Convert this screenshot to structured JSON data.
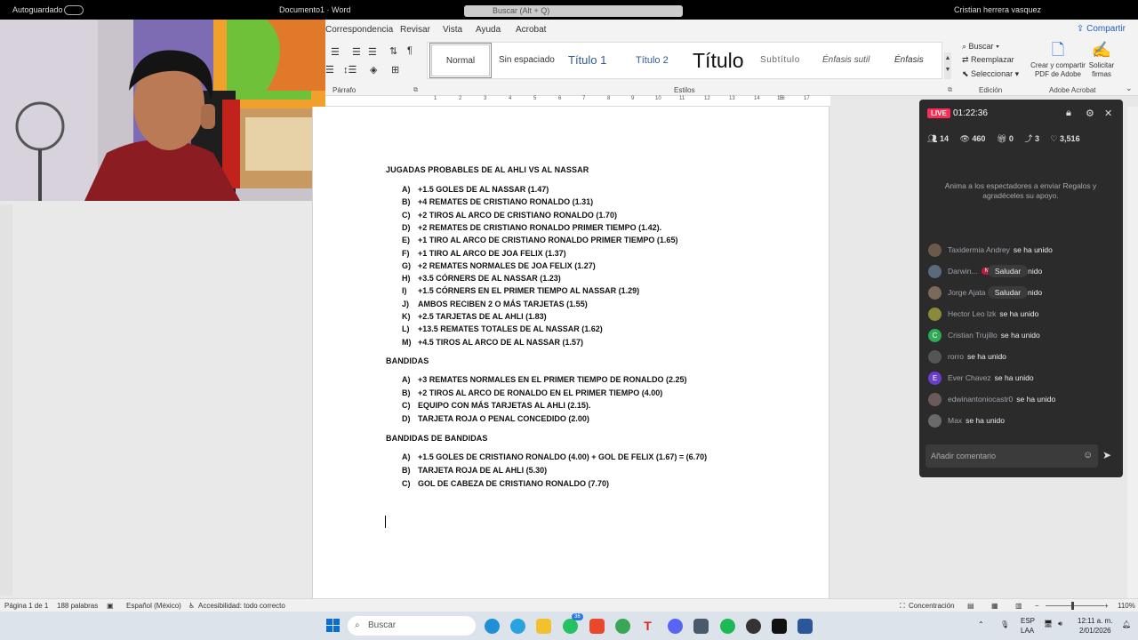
{
  "titlebar": {
    "autosave": "Autoguardado",
    "doc": "Documento1  ·  Word",
    "search": "Buscar (Alt + Q)",
    "user": "Cristian herrera vasquez"
  },
  "tabs": [
    "Correspondencia",
    "Revisar",
    "Vista",
    "Ayuda",
    "Acrobat"
  ],
  "share": "Compartir",
  "ribbon": {
    "parrafo": "Párrafo",
    "estilos_label": "Estilos",
    "styles": [
      "Normal",
      "Sin espaciado",
      "Título 1",
      "Título 2",
      "Título",
      "Subtítulo",
      "Énfasis sutil",
      "Énfasis"
    ],
    "edicion": {
      "buscar": "Buscar",
      "reemplazar": "Reemplazar",
      "seleccionar": "Seleccionar",
      "label": "Edición"
    },
    "acrobat": {
      "crear": "Crear y compartir",
      "crear2": "PDF de Adobe",
      "solicitar": "Solicitar",
      "solicitar2": "firmas",
      "label": "Adobe Acrobat"
    }
  },
  "ruler_ticks": [
    "1",
    "2",
    "3",
    "4",
    "5",
    "6",
    "7",
    "8",
    "9",
    "10",
    "11",
    "12",
    "13",
    "14",
    "15",
    "16",
    "17"
  ],
  "document": {
    "heading1": "JUGADAS PROBABLES DE AL AHLI VS AL NASSAR",
    "list1": [
      {
        "l": "A)",
        "t": "+1.5 GOLES DE AL NASSAR (1.47)"
      },
      {
        "l": "B)",
        "t": "+4 REMATES DE CRISTIANO RONALDO (1.31)"
      },
      {
        "l": "C)",
        "t": "+2 TIROS AL ARCO DE CRISTIANO RONALDO (1.70)"
      },
      {
        "l": "D)",
        "t": "+2 REMATES DE CRISTIANO RONALDO PRIMER TIEMPO (1.42)."
      },
      {
        "l": "E)",
        "t": "+1 TIRO AL ARCO DE CRISTIANO RONALDO PRIMER TIEMPO (1.65)"
      },
      {
        "l": "F)",
        "t": "+1 TIRO AL ARCO DE JOA FELIX (1.37)"
      },
      {
        "l": "G)",
        "t": "+2 REMATES NORMALES DE JOA FELIX (1.27)"
      },
      {
        "l": "H)",
        "t": "+3.5 CÓRNERS DE AL NASSAR (1.23)"
      },
      {
        "l": "I)",
        "t": "+1.5 CÓRNERS EN EL PRIMER TIEMPO AL NASSAR (1.29)"
      },
      {
        "l": "J)",
        "t": "AMBOS RECIBEN 2 O MÁS TARJETAS (1.55)"
      },
      {
        "l": "K)",
        "t": "+2.5 TARJETAS DE AL AHLI (1.83)"
      },
      {
        "l": "L)",
        "t": "+13.5 REMATES TOTALES DE AL NASSAR (1.62)"
      },
      {
        "l": "M)",
        "t": "+4.5 TIROS AL ARCO DE AL NASSAR (1.57)"
      }
    ],
    "heading2": "BANDIDAS",
    "list2": [
      {
        "l": "A)",
        "t": "+3 REMATES NORMALES EN EL PRIMER TIEMPO DE RONALDO (2.25)"
      },
      {
        "l": "B)",
        "t": "+2 TIROS AL ARCO DE RONALDO EN EL PRIMER TIEMPO (4.00)"
      },
      {
        "l": "C)",
        "t": "EQUIPO CON MÁS TARJETAS AL AHLI (2.15)."
      },
      {
        "l": "D)",
        "t": "TARJETA ROJA O PENAL CONCEDIDO (2.00)"
      }
    ],
    "heading3": "BANDIDAS DE BANDIDAS",
    "list3": [
      {
        "l": "A)",
        "t": "+1.5 GOLES DE CRISTIANO RONALDO (4.00) + GOL DE FELIX (1.67) = (6.70)"
      },
      {
        "l": "B)",
        "t": "TARJETA ROJA DE AL AHLI (5.30)"
      },
      {
        "l": "C)",
        "t": "GOL DE CABEZA DE CRISTIANO RONALDO (7.70)"
      }
    ]
  },
  "live": {
    "badge": "LIVE",
    "timer": "01:22:36",
    "stats": {
      "members": "14",
      "viewers": "460",
      "gifts": "0",
      "shares": "3",
      "likes": "3,516"
    },
    "gift_hint": "Anima a los espectadores a enviar Regalos y agradéceles su apoyo.",
    "messages": [
      {
        "name": "Taxidermia Andrey",
        "text": "se ha unido",
        "initial": "",
        "color": "#6b5a4a"
      },
      {
        "name": "Darwin...",
        "text": "se ha unido",
        "badge": "No.1",
        "saludar": "Saludar",
        "initial": "",
        "color": "#5a6a7a"
      },
      {
        "name": "Jorge Ajata R...",
        "text": "se ha unido",
        "saludar": "Saludar",
        "initial": "",
        "color": "#7a6a5a"
      },
      {
        "name": "Hector Leo lzk",
        "text": "se ha unido",
        "initial": "",
        "color": "#8a8a3a"
      },
      {
        "name": "Cristian Trujillo",
        "text": "se ha unido",
        "initial": "C",
        "color": "#2faa55"
      },
      {
        "name": "rorro",
        "text": "se ha unido",
        "initial": "",
        "color": "#555"
      },
      {
        "name": "Ever Chavez",
        "text": "se ha unido",
        "initial": "E",
        "color": "#6a3fc8"
      },
      {
        "name": "edwinantoniocastr0",
        "text": "se ha unido",
        "initial": "",
        "color": "#6a5a5a"
      },
      {
        "name": "Max",
        "text": "se ha unido",
        "initial": "",
        "color": "#6a6a6a"
      }
    ],
    "comment_placeholder": "Añadir comentario"
  },
  "status": {
    "page": "Página 1 de 1",
    "words": "188 palabras",
    "lang": "Español (México)",
    "access": "Accesibilidad: todo correcto",
    "focus": "Concentración",
    "zoom": "110%"
  },
  "taskbar": {
    "search": "Buscar",
    "badge": "36",
    "lang1": "ESP",
    "lang2": "LAA",
    "time": "12:11 a. m.",
    "date": "2/01/2026"
  }
}
